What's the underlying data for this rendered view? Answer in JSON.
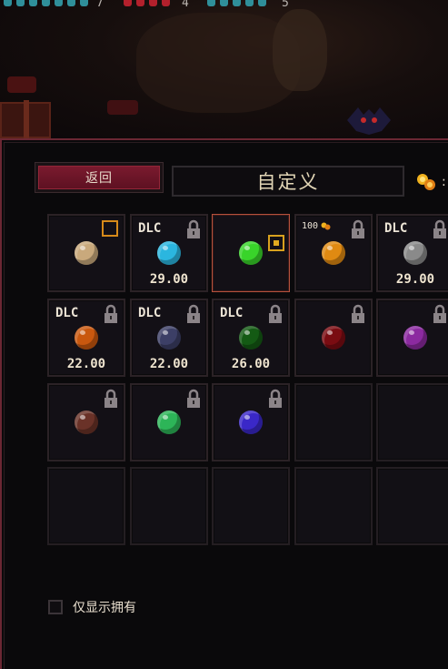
{
  "hud": {
    "values": [
      "7",
      "4",
      "5"
    ],
    "colors": {
      "teal": "#2f8f9a",
      "red": "#b3202c"
    }
  },
  "toolbar": {
    "back_label": "返回",
    "title": "自定义"
  },
  "grid": {
    "slots": [
      {
        "color": "#c9a97c",
        "dlc": "",
        "price": "",
        "locked": false,
        "marker": "box"
      },
      {
        "color": "#2bb6df",
        "dlc": "DLC",
        "price": "29.00",
        "locked": true,
        "marker": ""
      },
      {
        "color": "#39d42a",
        "dlc": "",
        "price": "",
        "locked": false,
        "marker": "target",
        "selected": true
      },
      {
        "color": "#e08a12",
        "dlc": "",
        "price": "",
        "locked": true,
        "marker": "",
        "cost": "100"
      },
      {
        "color": "#8a8a8a",
        "dlc": "DLC",
        "price": "29.00",
        "locked": true,
        "marker": ""
      },
      {
        "color": "#c9580f",
        "dlc": "DLC",
        "price": "22.00",
        "locked": true,
        "marker": ""
      },
      {
        "color": "#3c3f66",
        "dlc": "DLC",
        "price": "22.00",
        "locked": true,
        "marker": ""
      },
      {
        "color": "#145a14",
        "dlc": "DLC",
        "price": "26.00",
        "locked": true,
        "marker": ""
      },
      {
        "color": "#7a0c12",
        "dlc": "",
        "price": "",
        "locked": true,
        "marker": ""
      },
      {
        "color": "#8c2aa0",
        "dlc": "",
        "price": "",
        "locked": true,
        "marker": ""
      },
      {
        "color": "#6a3228",
        "dlc": "",
        "price": "",
        "locked": true,
        "marker": ""
      },
      {
        "color": "#2db558",
        "dlc": "",
        "price": "",
        "locked": true,
        "marker": ""
      },
      {
        "color": "#3a28c8",
        "dlc": "",
        "price": "",
        "locked": true,
        "marker": ""
      },
      {
        "empty": true
      },
      {
        "empty": true
      },
      {
        "empty": true
      },
      {
        "empty": true
      },
      {
        "empty": true
      },
      {
        "empty": true
      },
      {
        "empty": true
      }
    ]
  },
  "footer": {
    "owned_only_label": "仅显示拥有",
    "owned_only_checked": false
  }
}
